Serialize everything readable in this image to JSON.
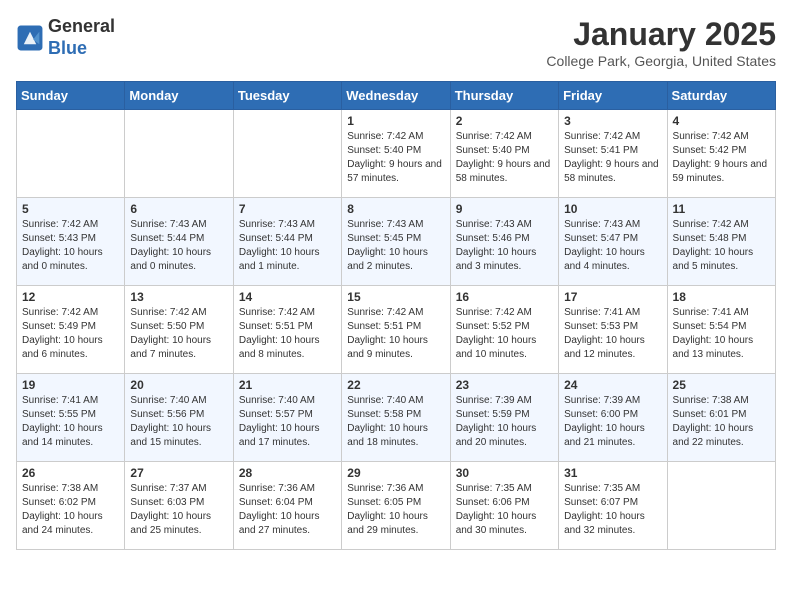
{
  "header": {
    "logo_line1": "General",
    "logo_line2": "Blue",
    "month": "January 2025",
    "location": "College Park, Georgia, United States"
  },
  "days_of_week": [
    "Sunday",
    "Monday",
    "Tuesday",
    "Wednesday",
    "Thursday",
    "Friday",
    "Saturday"
  ],
  "weeks": [
    [
      {
        "day": "",
        "info": ""
      },
      {
        "day": "",
        "info": ""
      },
      {
        "day": "",
        "info": ""
      },
      {
        "day": "1",
        "info": "Sunrise: 7:42 AM\nSunset: 5:40 PM\nDaylight: 9 hours and 57 minutes."
      },
      {
        "day": "2",
        "info": "Sunrise: 7:42 AM\nSunset: 5:40 PM\nDaylight: 9 hours and 58 minutes."
      },
      {
        "day": "3",
        "info": "Sunrise: 7:42 AM\nSunset: 5:41 PM\nDaylight: 9 hours and 58 minutes."
      },
      {
        "day": "4",
        "info": "Sunrise: 7:42 AM\nSunset: 5:42 PM\nDaylight: 9 hours and 59 minutes."
      }
    ],
    [
      {
        "day": "5",
        "info": "Sunrise: 7:42 AM\nSunset: 5:43 PM\nDaylight: 10 hours and 0 minutes."
      },
      {
        "day": "6",
        "info": "Sunrise: 7:43 AM\nSunset: 5:44 PM\nDaylight: 10 hours and 0 minutes."
      },
      {
        "day": "7",
        "info": "Sunrise: 7:43 AM\nSunset: 5:44 PM\nDaylight: 10 hours and 1 minute."
      },
      {
        "day": "8",
        "info": "Sunrise: 7:43 AM\nSunset: 5:45 PM\nDaylight: 10 hours and 2 minutes."
      },
      {
        "day": "9",
        "info": "Sunrise: 7:43 AM\nSunset: 5:46 PM\nDaylight: 10 hours and 3 minutes."
      },
      {
        "day": "10",
        "info": "Sunrise: 7:43 AM\nSunset: 5:47 PM\nDaylight: 10 hours and 4 minutes."
      },
      {
        "day": "11",
        "info": "Sunrise: 7:42 AM\nSunset: 5:48 PM\nDaylight: 10 hours and 5 minutes."
      }
    ],
    [
      {
        "day": "12",
        "info": "Sunrise: 7:42 AM\nSunset: 5:49 PM\nDaylight: 10 hours and 6 minutes."
      },
      {
        "day": "13",
        "info": "Sunrise: 7:42 AM\nSunset: 5:50 PM\nDaylight: 10 hours and 7 minutes."
      },
      {
        "day": "14",
        "info": "Sunrise: 7:42 AM\nSunset: 5:51 PM\nDaylight: 10 hours and 8 minutes."
      },
      {
        "day": "15",
        "info": "Sunrise: 7:42 AM\nSunset: 5:51 PM\nDaylight: 10 hours and 9 minutes."
      },
      {
        "day": "16",
        "info": "Sunrise: 7:42 AM\nSunset: 5:52 PM\nDaylight: 10 hours and 10 minutes."
      },
      {
        "day": "17",
        "info": "Sunrise: 7:41 AM\nSunset: 5:53 PM\nDaylight: 10 hours and 12 minutes."
      },
      {
        "day": "18",
        "info": "Sunrise: 7:41 AM\nSunset: 5:54 PM\nDaylight: 10 hours and 13 minutes."
      }
    ],
    [
      {
        "day": "19",
        "info": "Sunrise: 7:41 AM\nSunset: 5:55 PM\nDaylight: 10 hours and 14 minutes."
      },
      {
        "day": "20",
        "info": "Sunrise: 7:40 AM\nSunset: 5:56 PM\nDaylight: 10 hours and 15 minutes."
      },
      {
        "day": "21",
        "info": "Sunrise: 7:40 AM\nSunset: 5:57 PM\nDaylight: 10 hours and 17 minutes."
      },
      {
        "day": "22",
        "info": "Sunrise: 7:40 AM\nSunset: 5:58 PM\nDaylight: 10 hours and 18 minutes."
      },
      {
        "day": "23",
        "info": "Sunrise: 7:39 AM\nSunset: 5:59 PM\nDaylight: 10 hours and 20 minutes."
      },
      {
        "day": "24",
        "info": "Sunrise: 7:39 AM\nSunset: 6:00 PM\nDaylight: 10 hours and 21 minutes."
      },
      {
        "day": "25",
        "info": "Sunrise: 7:38 AM\nSunset: 6:01 PM\nDaylight: 10 hours and 22 minutes."
      }
    ],
    [
      {
        "day": "26",
        "info": "Sunrise: 7:38 AM\nSunset: 6:02 PM\nDaylight: 10 hours and 24 minutes."
      },
      {
        "day": "27",
        "info": "Sunrise: 7:37 AM\nSunset: 6:03 PM\nDaylight: 10 hours and 25 minutes."
      },
      {
        "day": "28",
        "info": "Sunrise: 7:36 AM\nSunset: 6:04 PM\nDaylight: 10 hours and 27 minutes."
      },
      {
        "day": "29",
        "info": "Sunrise: 7:36 AM\nSunset: 6:05 PM\nDaylight: 10 hours and 29 minutes."
      },
      {
        "day": "30",
        "info": "Sunrise: 7:35 AM\nSunset: 6:06 PM\nDaylight: 10 hours and 30 minutes."
      },
      {
        "day": "31",
        "info": "Sunrise: 7:35 AM\nSunset: 6:07 PM\nDaylight: 10 hours and 32 minutes."
      },
      {
        "day": "",
        "info": ""
      }
    ]
  ]
}
